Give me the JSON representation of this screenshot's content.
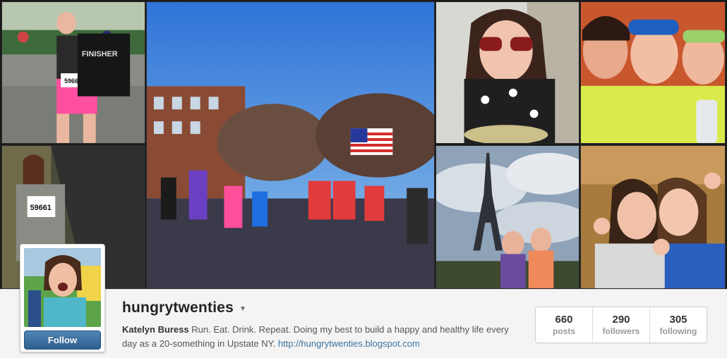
{
  "profile": {
    "username": "hungrytwenties",
    "full_name": "Katelyn Buress",
    "bio": "Run. Eat. Drink. Repeat. Doing my best to build a happy and healthy life every day as a 20-something in Upstate NY.",
    "website": "http://hungrytwenties.blogspot.com",
    "follow_label": "Follow",
    "caret_icon": "chevron-down-icon"
  },
  "stats": [
    {
      "value": "660",
      "label": "posts"
    },
    {
      "value": "290",
      "label": "followers"
    },
    {
      "value": "305",
      "label": "following"
    }
  ],
  "photos": {
    "bib_number": "59661",
    "shirt_text": "FINISHER"
  },
  "colors": {
    "follow_button": "#3f729b",
    "link": "#3f729b",
    "background": "#f4f4f4"
  }
}
